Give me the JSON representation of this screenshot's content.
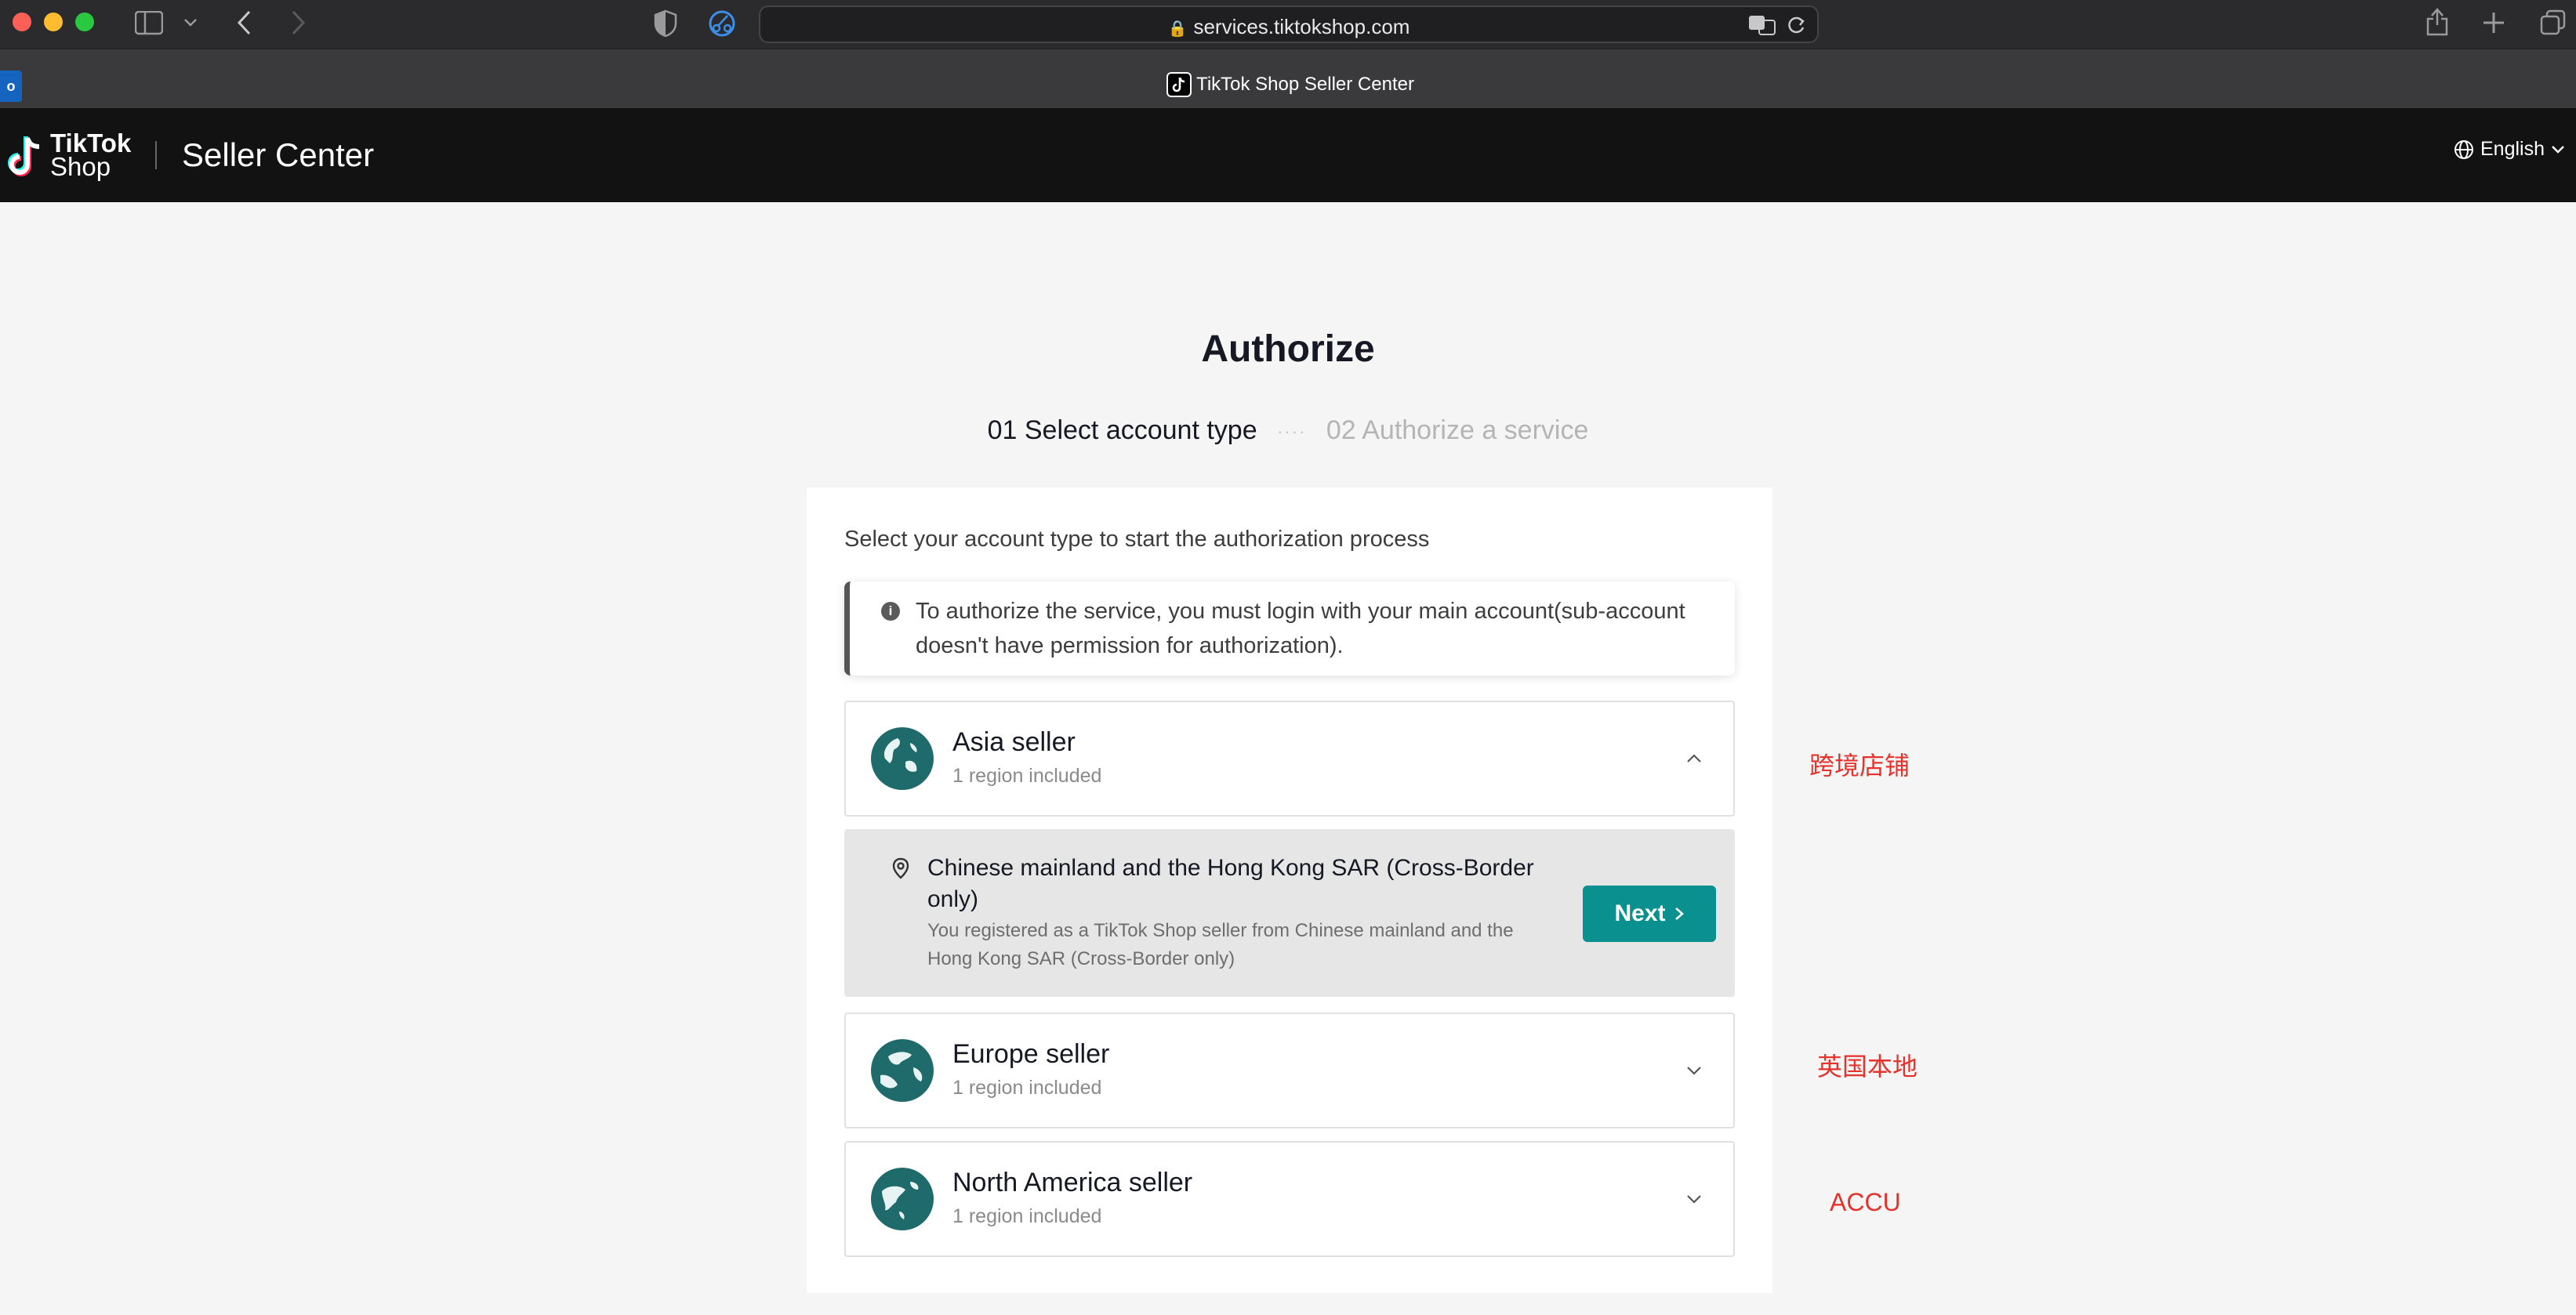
{
  "browser": {
    "url": "services.tiktokshop.com",
    "tab_title": "TikTok Shop Seller Center"
  },
  "header": {
    "brand_line1": "TikTok",
    "brand_line2": "Shop",
    "title": "Seller Center",
    "language": "English"
  },
  "page": {
    "title": "Authorize",
    "steps": {
      "step1": "01 Select account type",
      "separator": "····",
      "step2": "02 Authorize a service"
    },
    "intro": "Select your account type to start the authorization process",
    "notice": "To authorize the service, you must login with your main account(sub-account doesn't have permission for authorization).",
    "regions": [
      {
        "name": "Asia seller",
        "sub": "1 region included",
        "expanded": true
      },
      {
        "name": "Europe seller",
        "sub": "1 region included",
        "expanded": false
      },
      {
        "name": "North America seller",
        "sub": "1 region included",
        "expanded": false
      }
    ],
    "asia_option": {
      "title": "Chinese mainland and the Hong Kong SAR (Cross-Border only)",
      "desc": "You registered as a TikTok Shop seller from Chinese mainland and the Hong Kong SAR (Cross-Border only)",
      "next_label": "Next"
    }
  },
  "annotations": {
    "asia": "跨境店铺",
    "europe": "英国本地",
    "north_america": "ACCU"
  },
  "colors": {
    "accent": "#0b9090",
    "globe": "#1f6b6b",
    "annotation": "#e5322d"
  }
}
